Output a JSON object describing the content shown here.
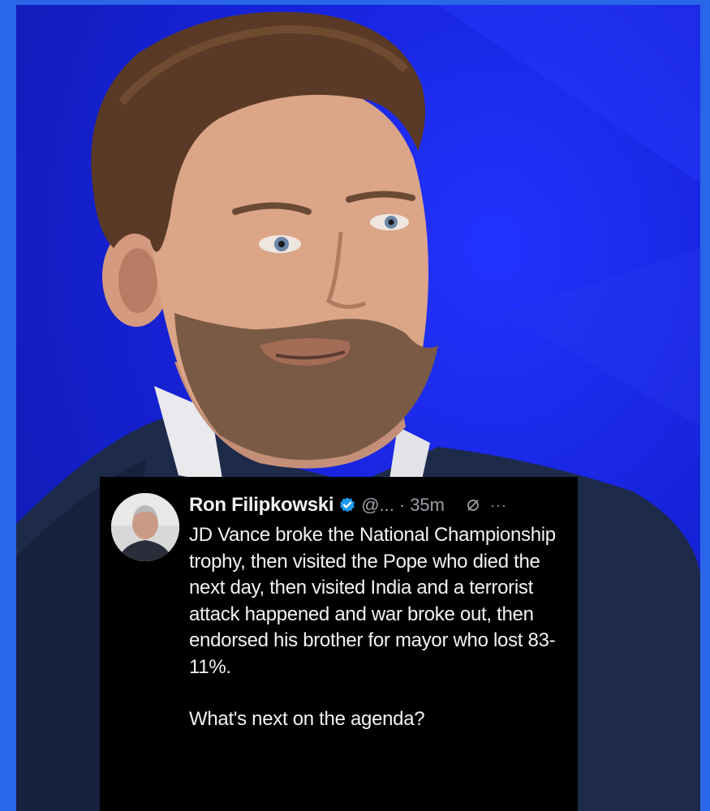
{
  "tweet": {
    "author_name": "Ron Filipkowski",
    "handle": "@...",
    "separator": "·",
    "time": "35m",
    "text_main": "JD Vance broke the National Championship trophy, then visited the Pope who died the next day, then visited India and a terrorist attack happened and war broke out, then endorsed his brother for mayor who lost 83-11%.",
    "text_followup": "What's next on the agenda?",
    "icons": {
      "verified": "verified-badge-icon",
      "grok": "grok-icon",
      "more": "more-icon"
    }
  },
  "colors": {
    "border": "#2a66e8",
    "backdrop": "#1622d8",
    "tweet_bg": "#000000",
    "tweet_text": "#f2f2f2",
    "handle_gray": "#9aa0a6",
    "verified_blue": "#1d9bf0"
  }
}
